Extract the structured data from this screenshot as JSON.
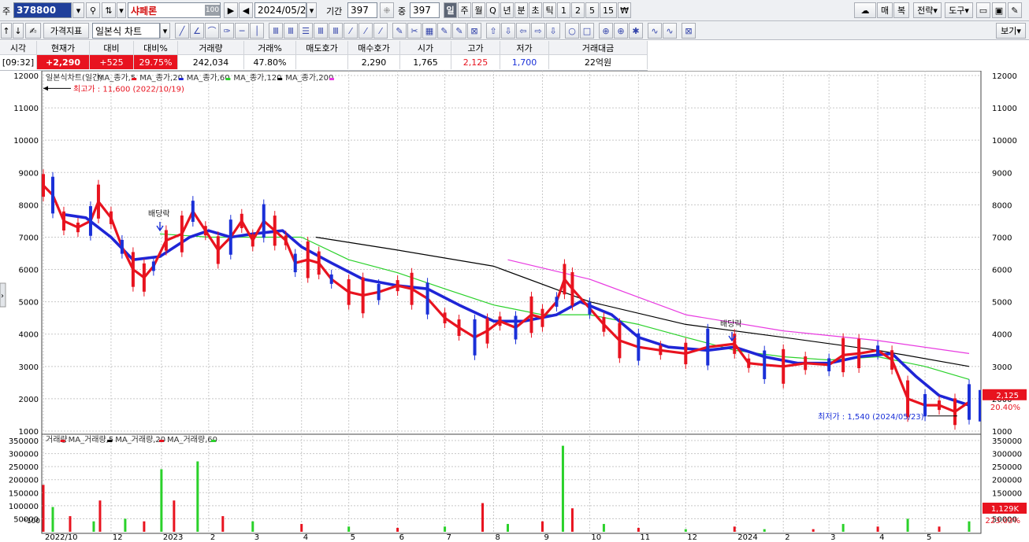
{
  "toolbar": {
    "code_prefix": "주",
    "stock_code": "378800",
    "stock_name": "샤페론",
    "name_badge": "100",
    "date": "2024/05/29",
    "period_label": "기간",
    "period_value": "397",
    "count_label": "중",
    "count_value": "397",
    "timeframes": [
      "일",
      "주",
      "월",
      "Q",
      "년",
      "분",
      "초",
      "틱",
      "1",
      "2",
      "5",
      "15",
      "₩"
    ],
    "right_buttons": [
      "매",
      "복",
      "전략",
      "도구"
    ],
    "price_indicator_label": "가격지표",
    "chart_type_label": "일본식 차트",
    "view_label": "보기"
  },
  "quote": {
    "headers": [
      "시각",
      "현재가",
      "대비",
      "대비%",
      "거래량",
      "거래%",
      "매도호가",
      "매수호가",
      "시가",
      "고가",
      "저가",
      "거래대금"
    ],
    "values": [
      "[09:32]",
      "+2,290",
      "+525",
      "29.75%",
      "242,034",
      "47.80%",
      "",
      "2,290",
      "1,765",
      "2,125",
      "1,700",
      "22억원"
    ]
  },
  "colors": {
    "up": "#e8131f",
    "down": "#1a30d8",
    "ma5": "#e8131f",
    "ma20": "#1f25d6",
    "ma60": "#2ad12a",
    "ma120": "#000000",
    "ma200": "#e83ae0"
  },
  "price_panel": {
    "legend": [
      "일본식차트(일간)",
      "MA_종가,5",
      "MA_종가,20",
      "MA_종가,60",
      "MA_종가,120",
      "MA_종가,200"
    ],
    "high_label": "최고가 : 11,600 (2022/10/19)",
    "low_label": "최저가 : 1,540 (2024/05/23)",
    "dividend_labels": [
      "배당락",
      "배당락"
    ],
    "current_price_tag": "2,125",
    "current_pct_tag": "20.40%"
  },
  "volume_panel": {
    "legend": [
      "거래량",
      "MA_거래량,5",
      "MA_거래량,20",
      "MA_거래량,60"
    ],
    "unit_label": "*100",
    "current_tag": "1,129K",
    "current_pct_tag": "223.03%"
  },
  "chart_data": {
    "type": "line",
    "price_axis": {
      "ylim": [
        1000,
        12000
      ],
      "ticks": [
        1000,
        2000,
        3000,
        4000,
        5000,
        6000,
        7000,
        8000,
        9000,
        10000,
        11000,
        12000
      ]
    },
    "volume_axis": {
      "ylim": [
        0,
        350000
      ],
      "ticks": [
        50000,
        100000,
        150000,
        200000,
        250000,
        300000,
        350000
      ]
    },
    "x_ticks": [
      "2022/10",
      "12",
      "2023",
      "2",
      "3",
      "4",
      "5",
      "6",
      "7",
      "8",
      "9",
      "10",
      "11",
      "12",
      "2024",
      "2",
      "3",
      "4",
      "5"
    ],
    "series": [
      {
        "name": "MA_종가,5",
        "values": [
          {
            "x": "2022/10/19",
            "y": 8600
          },
          {
            "x": "2022/10/25",
            "y": 8300
          },
          {
            "x": "2022/11/01",
            "y": 7500
          },
          {
            "x": "2022/11/10",
            "y": 7300
          },
          {
            "x": "2022/11/18",
            "y": 7500
          },
          {
            "x": "2022/11/23",
            "y": 8100
          },
          {
            "x": "2022/12/01",
            "y": 7600
          },
          {
            "x": "2022/12/08",
            "y": 6700
          },
          {
            "x": "2022/12/15",
            "y": 6000
          },
          {
            "x": "2022/12/22",
            "y": 5750
          },
          {
            "x": "2022/12/28",
            "y": 6100
          },
          {
            "x": "2023/01/05",
            "y": 6900
          },
          {
            "x": "2023/01/15",
            "y": 7100
          },
          {
            "x": "2023/01/22",
            "y": 7800
          },
          {
            "x": "2023/01/30",
            "y": 7200
          },
          {
            "x": "2023/02/07",
            "y": 6600
          },
          {
            "x": "2023/02/15",
            "y": 7000
          },
          {
            "x": "2023/02/22",
            "y": 7500
          },
          {
            "x": "2023/03/01",
            "y": 6900
          },
          {
            "x": "2023/03/08",
            "y": 7500
          },
          {
            "x": "2023/03/15",
            "y": 7200
          },
          {
            "x": "2023/03/22",
            "y": 6900
          },
          {
            "x": "2023/03/28",
            "y": 6200
          },
          {
            "x": "2023/04/05",
            "y": 6300
          },
          {
            "x": "2023/04/12",
            "y": 6200
          },
          {
            "x": "2023/04/20",
            "y": 5700
          },
          {
            "x": "2023/05/01",
            "y": 5300
          },
          {
            "x": "2023/05/10",
            "y": 5200
          },
          {
            "x": "2023/05/20",
            "y": 5300
          },
          {
            "x": "2023/06/01",
            "y": 5500
          },
          {
            "x": "2023/06/10",
            "y": 5400
          },
          {
            "x": "2023/06/20",
            "y": 5100
          },
          {
            "x": "2023/07/01",
            "y": 4500
          },
          {
            "x": "2023/07/10",
            "y": 4200
          },
          {
            "x": "2023/07/20",
            "y": 3900
          },
          {
            "x": "2023/07/28",
            "y": 4100
          },
          {
            "x": "2023/08/05",
            "y": 4400
          },
          {
            "x": "2023/08/15",
            "y": 4200
          },
          {
            "x": "2023/08/25",
            "y": 4600
          },
          {
            "x": "2023/09/01",
            "y": 4500
          },
          {
            "x": "2023/09/10",
            "y": 5000
          },
          {
            "x": "2023/09/15",
            "y": 5700
          },
          {
            "x": "2023/09/20",
            "y": 5400
          },
          {
            "x": "2023/10/01",
            "y": 4800
          },
          {
            "x": "2023/10/10",
            "y": 4300
          },
          {
            "x": "2023/10/20",
            "y": 3800
          },
          {
            "x": "2023/11/01",
            "y": 3600
          },
          {
            "x": "2023/11/15",
            "y": 3500
          },
          {
            "x": "2023/12/01",
            "y": 3400
          },
          {
            "x": "2023/12/15",
            "y": 3600
          },
          {
            "x": "2024/01/01",
            "y": 3700
          },
          {
            "x": "2024/01/10",
            "y": 3100
          },
          {
            "x": "2024/01/20",
            "y": 3050
          },
          {
            "x": "2024/02/01",
            "y": 3000
          },
          {
            "x": "2024/02/15",
            "y": 3100
          },
          {
            "x": "2024/03/01",
            "y": 3050
          },
          {
            "x": "2024/03/10",
            "y": 3350
          },
          {
            "x": "2024/03/20",
            "y": 3400
          },
          {
            "x": "2024/04/01",
            "y": 3500
          },
          {
            "x": "2024/04/10",
            "y": 3200
          },
          {
            "x": "2024/04/20",
            "y": 2000
          },
          {
            "x": "2024/05/01",
            "y": 1800
          },
          {
            "x": "2024/05/10",
            "y": 1800
          },
          {
            "x": "2024/05/20",
            "y": 1600
          },
          {
            "x": "2024/05/29",
            "y": 1900
          }
        ]
      },
      {
        "name": "MA_종가,20",
        "values": [
          {
            "x": "2022/11/01",
            "y": 7700
          },
          {
            "x": "2022/11/15",
            "y": 7600
          },
          {
            "x": "2022/12/01",
            "y": 7000
          },
          {
            "x": "2022/12/15",
            "y": 6300
          },
          {
            "x": "2023/01/01",
            "y": 6400
          },
          {
            "x": "2023/01/20",
            "y": 7000
          },
          {
            "x": "2023/02/01",
            "y": 7200
          },
          {
            "x": "2023/02/15",
            "y": 7000
          },
          {
            "x": "2023/03/01",
            "y": 7100
          },
          {
            "x": "2023/03/20",
            "y": 7200
          },
          {
            "x": "2023/04/01",
            "y": 6700
          },
          {
            "x": "2023/04/20",
            "y": 6200
          },
          {
            "x": "2023/05/10",
            "y": 5700
          },
          {
            "x": "2023/06/01",
            "y": 5500
          },
          {
            "x": "2023/06/20",
            "y": 5400
          },
          {
            "x": "2023/07/10",
            "y": 4900
          },
          {
            "x": "2023/08/01",
            "y": 4400
          },
          {
            "x": "2023/08/20",
            "y": 4400
          },
          {
            "x": "2023/09/10",
            "y": 4600
          },
          {
            "x": "2023/09/25",
            "y": 5000
          },
          {
            "x": "2023/10/15",
            "y": 4600
          },
          {
            "x": "2023/11/01",
            "y": 3900
          },
          {
            "x": "2023/11/20",
            "y": 3600
          },
          {
            "x": "2023/12/15",
            "y": 3500
          },
          {
            "x": "2024/01/01",
            "y": 3600
          },
          {
            "x": "2024/01/20",
            "y": 3300
          },
          {
            "x": "2024/02/10",
            "y": 3100
          },
          {
            "x": "2024/03/01",
            "y": 3100
          },
          {
            "x": "2024/03/20",
            "y": 3300
          },
          {
            "x": "2024/04/10",
            "y": 3400
          },
          {
            "x": "2024/04/25",
            "y": 2700
          },
          {
            "x": "2024/05/10",
            "y": 2100
          },
          {
            "x": "2024/05/29",
            "y": 1800
          }
        ]
      },
      {
        "name": "MA_종가,60",
        "values": [
          {
            "x": "2023/01/01",
            "y": 7100
          },
          {
            "x": "2023/02/01",
            "y": 7000
          },
          {
            "x": "2023/03/01",
            "y": 7000
          },
          {
            "x": "2023/04/01",
            "y": 7000
          },
          {
            "x": "2023/05/01",
            "y": 6300
          },
          {
            "x": "2023/06/01",
            "y": 5900
          },
          {
            "x": "2023/07/01",
            "y": 5400
          },
          {
            "x": "2023/08/01",
            "y": 4900
          },
          {
            "x": "2023/09/01",
            "y": 4600
          },
          {
            "x": "2023/10/01",
            "y": 4600
          },
          {
            "x": "2023/11/01",
            "y": 4300
          },
          {
            "x": "2023/12/01",
            "y": 3900
          },
          {
            "x": "2024/01/01",
            "y": 3500
          },
          {
            "x": "2024/02/01",
            "y": 3300
          },
          {
            "x": "2024/03/01",
            "y": 3200
          },
          {
            "x": "2024/04/01",
            "y": 3300
          },
          {
            "x": "2024/05/01",
            "y": 3000
          },
          {
            "x": "2024/05/29",
            "y": 2600
          }
        ]
      },
      {
        "name": "MA_종가,120",
        "values": [
          {
            "x": "2023/04/10",
            "y": 7000
          },
          {
            "x": "2023/06/01",
            "y": 6600
          },
          {
            "x": "2023/08/01",
            "y": 6100
          },
          {
            "x": "2023/10/01",
            "y": 5000
          },
          {
            "x": "2023/12/01",
            "y": 4300
          },
          {
            "x": "2024/02/01",
            "y": 3900
          },
          {
            "x": "2024/04/01",
            "y": 3500
          },
          {
            "x": "2024/05/29",
            "y": 3000
          }
        ]
      },
      {
        "name": "MA_종가,200",
        "values": [
          {
            "x": "2023/08/10",
            "y": 6300
          },
          {
            "x": "2023/10/01",
            "y": 5700
          },
          {
            "x": "2023/12/01",
            "y": 4600
          },
          {
            "x": "2024/02/01",
            "y": 4100
          },
          {
            "x": "2024/04/01",
            "y": 3800
          },
          {
            "x": "2024/05/29",
            "y": 3400
          }
        ]
      },
      {
        "name": "거래량",
        "values": [
          {
            "x": "2022/10/19",
            "y": 180000
          },
          {
            "x": "2022/10/25",
            "y": 95000
          },
          {
            "x": "2022/11/05",
            "y": 60000
          },
          {
            "x": "2022/11/20",
            "y": 40000
          },
          {
            "x": "2022/11/24",
            "y": 120000
          },
          {
            "x": "2022/12/10",
            "y": 50000
          },
          {
            "x": "2022/12/22",
            "y": 40000
          },
          {
            "x": "2023/01/02",
            "y": 240000
          },
          {
            "x": "2023/01/10",
            "y": 120000
          },
          {
            "x": "2023/01/25",
            "y": 270000
          },
          {
            "x": "2023/02/10",
            "y": 60000
          },
          {
            "x": "2023/03/01",
            "y": 40000
          },
          {
            "x": "2023/04/01",
            "y": 30000
          },
          {
            "x": "2023/05/01",
            "y": 20000
          },
          {
            "x": "2023/06/01",
            "y": 15000
          },
          {
            "x": "2023/07/01",
            "y": 20000
          },
          {
            "x": "2023/07/25",
            "y": 110000
          },
          {
            "x": "2023/08/10",
            "y": 30000
          },
          {
            "x": "2023/09/01",
            "y": 40000
          },
          {
            "x": "2023/09/14",
            "y": 330000
          },
          {
            "x": "2023/09/20",
            "y": 90000
          },
          {
            "x": "2023/10/10",
            "y": 30000
          },
          {
            "x": "2023/11/01",
            "y": 15000
          },
          {
            "x": "2023/12/01",
            "y": 10000
          },
          {
            "x": "2024/01/01",
            "y": 20000
          },
          {
            "x": "2024/01/20",
            "y": 10000
          },
          {
            "x": "2024/02/20",
            "y": 10000
          },
          {
            "x": "2024/03/10",
            "y": 30000
          },
          {
            "x": "2024/04/01",
            "y": 20000
          },
          {
            "x": "2024/04/20",
            "y": 50000
          },
          {
            "x": "2024/05/10",
            "y": 20000
          },
          {
            "x": "2024/05/29",
            "y": 40000
          }
        ]
      }
    ]
  }
}
